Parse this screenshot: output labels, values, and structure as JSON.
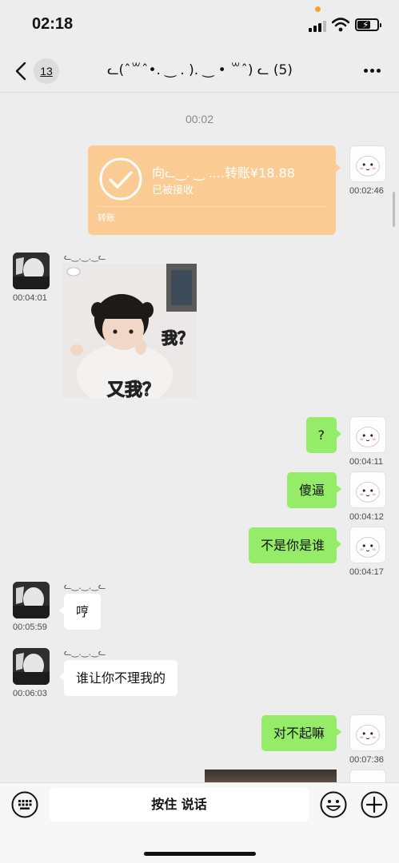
{
  "status_bar": {
    "time": "02:18"
  },
  "nav": {
    "unread_count": "13",
    "title": "ᓚ(ˆ꒳ˆ•. ‿ . ). ‿ • ꒳ˆ) ᓚ (5)",
    "back_icon": "chevron-left-icon",
    "more_icon": "ellipsis-icon"
  },
  "messages": {
    "divider_time": "00:02",
    "transfer": {
      "title": "向ᓚ‿. ‿ ....转账¥18.88",
      "status": "已被接收",
      "type_label": "转账",
      "time": "00:02:46",
      "color": "#fbcb94"
    },
    "sticker": {
      "sender": "ᓚ‿.‿.‿ᓚ",
      "time": "00:04:01",
      "text_top": "我？",
      "text_bottom": "又我？"
    },
    "m1": {
      "text": "?",
      "time": "00:04:11"
    },
    "m2": {
      "text": "傻逼",
      "time": "00:04:12"
    },
    "m3": {
      "text": "不是你是谁",
      "time": "00:04:17"
    },
    "m4": {
      "sender": "ᓚ‿.‿.‿ᓚ",
      "text": "哼",
      "time": "00:05:59"
    },
    "m5": {
      "sender": "ᓚ‿.‿.‿ᓚ",
      "text": "谁让你不理我的",
      "time": "00:06:03"
    },
    "m6": {
      "text": "对不起嘛",
      "time": "00:07:36"
    }
  },
  "input_bar": {
    "voice_label": "按住 说话",
    "keyboard_icon": "keyboard-icon",
    "emoji_icon": "smiley-icon",
    "plus_icon": "plus-circle-icon"
  },
  "colors": {
    "my_bubble": "#95ec69",
    "other_bubble": "#ffffff",
    "background": "#ededed"
  }
}
